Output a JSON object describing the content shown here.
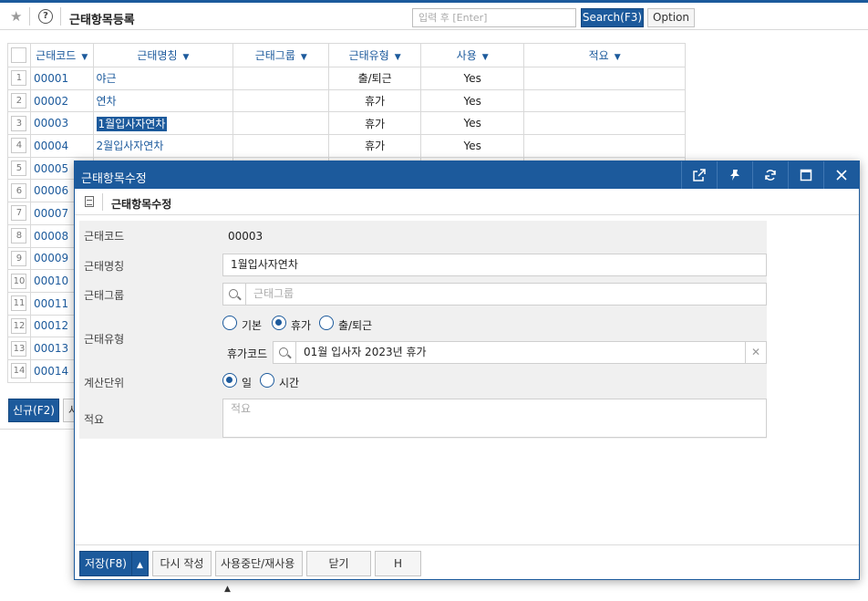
{
  "toolbar": {
    "title": "근태항목등록",
    "search_placeholder": "입력 후 [Enter]",
    "search_label": "Search(F3)",
    "option_label": "Option"
  },
  "grid": {
    "headers": [
      "근태코드",
      "근태명칭",
      "근태그룹",
      "근태유형",
      "사용",
      "적요"
    ],
    "rows": [
      {
        "num": "1",
        "code": "00001",
        "name": "야근",
        "group": "",
        "type": "출/퇴근",
        "use": "Yes",
        "desc": ""
      },
      {
        "num": "2",
        "code": "00002",
        "name": "연차",
        "group": "",
        "type": "휴가",
        "use": "Yes",
        "desc": ""
      },
      {
        "num": "3",
        "code": "00003",
        "name": "1월입사자연차",
        "group": "",
        "type": "휴가",
        "use": "Yes",
        "desc": ""
      },
      {
        "num": "4",
        "code": "00004",
        "name": "2월입사자연차",
        "group": "",
        "type": "휴가",
        "use": "Yes",
        "desc": ""
      },
      {
        "num": "5",
        "code": "00005"
      },
      {
        "num": "6",
        "code": "00006"
      },
      {
        "num": "7",
        "code": "00007"
      },
      {
        "num": "8",
        "code": "00008"
      },
      {
        "num": "9",
        "code": "00009"
      },
      {
        "num": "10",
        "code": "00010"
      },
      {
        "num": "11",
        "code": "00011"
      },
      {
        "num": "12",
        "code": "00012"
      },
      {
        "num": "13",
        "code": "00013"
      },
      {
        "num": "14",
        "code": "00014"
      }
    ]
  },
  "page_buttons": {
    "new_label": "신규(F2)",
    "partial_label": "사"
  },
  "modal": {
    "title": "근태항목수정",
    "subtitle": "근태항목수정",
    "fields": {
      "code_label": "근태코드",
      "code_value": "00003",
      "name_label": "근태명칭",
      "name_value": "1월입사자연차",
      "group_label": "근태그룹",
      "group_placeholder": "근태그룹",
      "type_label": "근태유형",
      "type_options": [
        "기본",
        "휴가",
        "출/퇴근"
      ],
      "type_selected": "휴가",
      "leave_code_label": "휴가코드",
      "leave_code_value": "01월 입사자 2023년 휴가",
      "unit_label": "계산단위",
      "unit_options": [
        "일",
        "시간"
      ],
      "unit_selected": "일",
      "desc_label": "적요",
      "desc_placeholder": "적요"
    },
    "footer": {
      "save_label": "저장(F8)",
      "rewrite_label": "다시 작성",
      "toggle_label": "사용중단/재사용",
      "close_label": "닫기",
      "h_label": "H"
    }
  },
  "colors": {
    "accent": "#1c5a9c"
  }
}
